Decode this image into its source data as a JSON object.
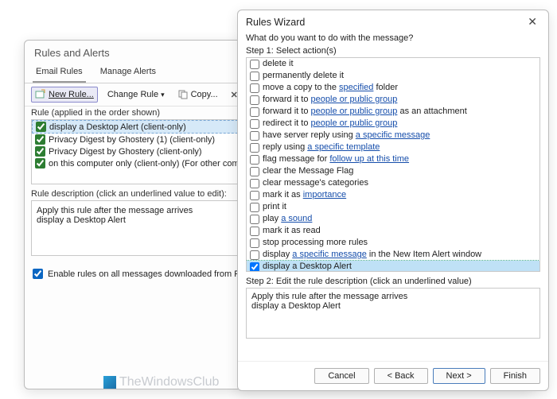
{
  "bg": {
    "title": "Rules and Alerts",
    "tabs": {
      "email": "Email Rules",
      "manage": "Manage Alerts"
    },
    "toolbar": {
      "new_rule": "New Rule...",
      "change_rule": "Change Rule",
      "copy": "Copy...",
      "delete": "Delete"
    },
    "rule_header": "Rule (applied in the order shown)",
    "rules": [
      "display a Desktop Alert  (client-only)",
      "Privacy Digest by Ghostery (1)  (client-only)",
      "Privacy Digest by Ghostery  (client-only)",
      "on this computer only  (client-only)  (For other computer"
    ],
    "desc_label": "Rule description (click an underlined value to edit):",
    "desc_line1": "Apply this rule after the message arrives",
    "desc_line2": "display a Desktop Alert",
    "rss_label": "Enable rules on all messages downloaded from RSS F"
  },
  "fg": {
    "title": "Rules Wizard",
    "prompt": "What do you want to do with the message?",
    "step1": "Step 1: Select action(s)",
    "step2": "Step 2: Edit the rule description (click an underlined value)",
    "desc_line1": "Apply this rule after the message arrives",
    "desc_line2": "display a Desktop Alert",
    "buttons": {
      "cancel": "Cancel",
      "back": "< Back",
      "next": "Next >",
      "finish": "Finish"
    },
    "actions": [
      {
        "pre": "delete it"
      },
      {
        "pre": "permanently delete it"
      },
      {
        "pre": "move a copy to the ",
        "link": "specified",
        "post": " folder"
      },
      {
        "pre": "forward it to ",
        "link": "people or public group"
      },
      {
        "pre": "forward it to ",
        "link": "people or public group",
        "post": " as an attachment"
      },
      {
        "pre": "redirect it to ",
        "link": "people or public group"
      },
      {
        "pre": "have server reply using ",
        "link": "a specific message"
      },
      {
        "pre": "reply using ",
        "link": "a specific template"
      },
      {
        "pre": "flag message for ",
        "link": "follow up at this time"
      },
      {
        "pre": "clear the Message Flag"
      },
      {
        "pre": "clear message's categories"
      },
      {
        "pre": "mark it as ",
        "link": "importance"
      },
      {
        "pre": "print it"
      },
      {
        "pre": "play ",
        "link": "a sound"
      },
      {
        "pre": "mark it as read"
      },
      {
        "pre": "stop processing more rules"
      },
      {
        "pre": "display ",
        "link": "a specific message",
        "post": " in the New Item Alert window"
      },
      {
        "pre": "display a Desktop Alert",
        "checked": true,
        "selected": true
      }
    ]
  },
  "watermark": "TheWindowsClub"
}
